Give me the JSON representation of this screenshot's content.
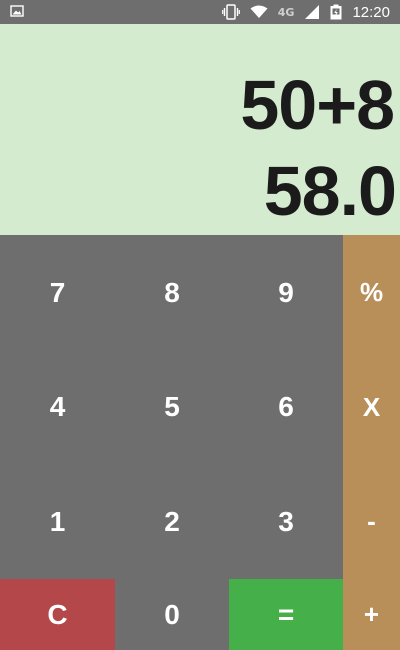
{
  "status_bar": {
    "network_type": "4G",
    "time": "12:20"
  },
  "display": {
    "expression": "50+8",
    "result": "58.0"
  },
  "keypad": {
    "row1": [
      "7",
      "8",
      "9"
    ],
    "row2": [
      "4",
      "5",
      "6"
    ],
    "row3": [
      "1",
      "2",
      "3"
    ],
    "clear": "C",
    "zero": "0",
    "equals": "=",
    "ops": {
      "percent": "%",
      "multiply": "X",
      "minus": "-",
      "plus": "+"
    }
  },
  "colors": {
    "display_bg": "#d4ebcf",
    "keypad_bg": "#6e6e6e",
    "ops_bg": "#b88f58",
    "clear_bg": "#b3474a",
    "equals_bg": "#45b049"
  }
}
